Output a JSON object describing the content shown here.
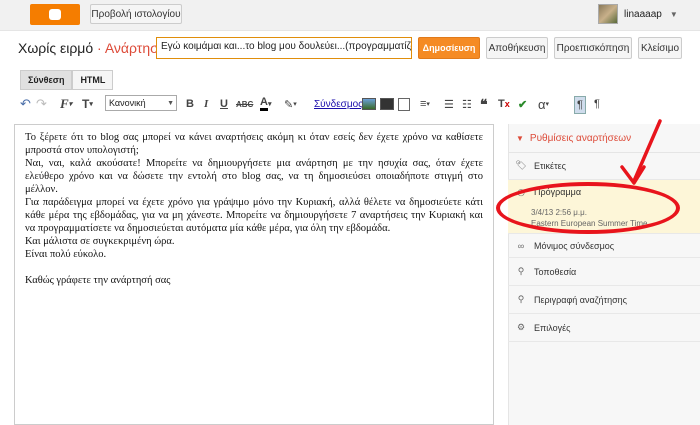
{
  "topbar": {
    "logo": "blogger-logo",
    "view_blog_label": "Προβολή ιστολογίου",
    "user_name": "linaaaap"
  },
  "header": {
    "blog_name": "Χωρίς ειρμό",
    "separator": "·",
    "page": "Ανάρτηση",
    "post_title": "Εγώ κοιμάμαι και...το blog μου δουλεύει...(προγραμματίζω ανάρτ",
    "publish_label": "Δημοσίευση",
    "save_label": "Αποθήκευση",
    "preview_label": "Προεπισκόπηση",
    "close_label": "Κλείσιμο"
  },
  "modes": {
    "compose": "Σύνθεση",
    "html": "HTML"
  },
  "toolbar": {
    "size_value": "Κανονική",
    "link_label": "Σύνδεσμος",
    "font_label": "F",
    "text_size_label": "T",
    "bold": "B",
    "italic": "I",
    "underline": "U",
    "strike": "ABC",
    "text_color": "A",
    "special_char": "α"
  },
  "editor": {
    "paragraphs": [
      "Το ξέρετε ότι το blog σας μπορεί να κάνει αναρτήσεις ακόμη κι όταν εσείς δεν έχετε χρόνο να καθίσετε μπροστά στον υπολογιστή;",
      "Ναι, ναι, καλά ακούσατε! Μπορείτε να δημιουργήσετε μια ανάρτηση με την ησυχία σας, όταν έχετε ελεύθερο χρόνο και να δώσετε την εντολή στο blog σας, να τη δημοσιεύσει οποιαδήποτε στιγμή στο μέλλον.",
      "Για παράδειγμα μπορεί να έχετε χρόνο για γράψιμο μόνο την Κυριακή, αλλά θέλετε να δημοσιεύετε κάτι κάθε μέρα της εβδομάδας, για να μη χάνεστε. Μπορείτε να δημιουργήσετε 7 αναρτήσεις την Κυριακή και να προγραμματίσετε να δημοσιεύεται αυτόματα μία κάθε μέρα, για όλη την εβδομάδα.",
      "Και μάλιστα σε συγκεκριμένη ώρα.",
      "Είναι πολύ εύκολο."
    ],
    "last_line": "Καθώς γράφετε την ανάρτησή σας"
  },
  "sidebar": {
    "heading": "Ρυθμίσεις αναρτήσεων",
    "labels": "Ετικέτες",
    "schedule": "Πρόγραμμα",
    "schedule_date": "3/4/13 2:56 μ.μ.",
    "schedule_tz": "Eastern European Summer Time",
    "permalink": "Μόνιμος σύνδεσμος",
    "location": "Τοποθεσία",
    "search_desc": "Περιγραφή αναζήτησης",
    "options": "Επιλογές"
  },
  "colors": {
    "accent": "#dd4b39",
    "publish": "#f58b24",
    "annotation": "#e8141c",
    "schedule_bg": "#fdf6d8"
  }
}
